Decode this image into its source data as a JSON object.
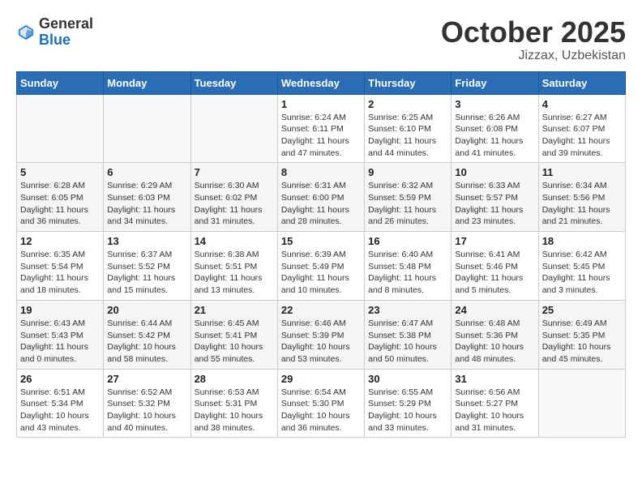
{
  "logo": {
    "general": "General",
    "blue": "Blue"
  },
  "title": "October 2025",
  "location": "Jizzax, Uzbekistan",
  "days_header": [
    "Sunday",
    "Monday",
    "Tuesday",
    "Wednesday",
    "Thursday",
    "Friday",
    "Saturday"
  ],
  "weeks": [
    [
      {
        "day": "",
        "info": ""
      },
      {
        "day": "",
        "info": ""
      },
      {
        "day": "",
        "info": ""
      },
      {
        "day": "1",
        "info": "Sunrise: 6:24 AM\nSunset: 6:11 PM\nDaylight: 11 hours\nand 47 minutes."
      },
      {
        "day": "2",
        "info": "Sunrise: 6:25 AM\nSunset: 6:10 PM\nDaylight: 11 hours\nand 44 minutes."
      },
      {
        "day": "3",
        "info": "Sunrise: 6:26 AM\nSunset: 6:08 PM\nDaylight: 11 hours\nand 41 minutes."
      },
      {
        "day": "4",
        "info": "Sunrise: 6:27 AM\nSunset: 6:07 PM\nDaylight: 11 hours\nand 39 minutes."
      }
    ],
    [
      {
        "day": "5",
        "info": "Sunrise: 6:28 AM\nSunset: 6:05 PM\nDaylight: 11 hours\nand 36 minutes."
      },
      {
        "day": "6",
        "info": "Sunrise: 6:29 AM\nSunset: 6:03 PM\nDaylight: 11 hours\nand 34 minutes."
      },
      {
        "day": "7",
        "info": "Sunrise: 6:30 AM\nSunset: 6:02 PM\nDaylight: 11 hours\nand 31 minutes."
      },
      {
        "day": "8",
        "info": "Sunrise: 6:31 AM\nSunset: 6:00 PM\nDaylight: 11 hours\nand 28 minutes."
      },
      {
        "day": "9",
        "info": "Sunrise: 6:32 AM\nSunset: 5:59 PM\nDaylight: 11 hours\nand 26 minutes."
      },
      {
        "day": "10",
        "info": "Sunrise: 6:33 AM\nSunset: 5:57 PM\nDaylight: 11 hours\nand 23 minutes."
      },
      {
        "day": "11",
        "info": "Sunrise: 6:34 AM\nSunset: 5:56 PM\nDaylight: 11 hours\nand 21 minutes."
      }
    ],
    [
      {
        "day": "12",
        "info": "Sunrise: 6:35 AM\nSunset: 5:54 PM\nDaylight: 11 hours\nand 18 minutes."
      },
      {
        "day": "13",
        "info": "Sunrise: 6:37 AM\nSunset: 5:52 PM\nDaylight: 11 hours\nand 15 minutes."
      },
      {
        "day": "14",
        "info": "Sunrise: 6:38 AM\nSunset: 5:51 PM\nDaylight: 11 hours\nand 13 minutes."
      },
      {
        "day": "15",
        "info": "Sunrise: 6:39 AM\nSunset: 5:49 PM\nDaylight: 11 hours\nand 10 minutes."
      },
      {
        "day": "16",
        "info": "Sunrise: 6:40 AM\nSunset: 5:48 PM\nDaylight: 11 hours\nand 8 minutes."
      },
      {
        "day": "17",
        "info": "Sunrise: 6:41 AM\nSunset: 5:46 PM\nDaylight: 11 hours\nand 5 minutes."
      },
      {
        "day": "18",
        "info": "Sunrise: 6:42 AM\nSunset: 5:45 PM\nDaylight: 11 hours\nand 3 minutes."
      }
    ],
    [
      {
        "day": "19",
        "info": "Sunrise: 6:43 AM\nSunset: 5:43 PM\nDaylight: 11 hours\nand 0 minutes."
      },
      {
        "day": "20",
        "info": "Sunrise: 6:44 AM\nSunset: 5:42 PM\nDaylight: 10 hours\nand 58 minutes."
      },
      {
        "day": "21",
        "info": "Sunrise: 6:45 AM\nSunset: 5:41 PM\nDaylight: 10 hours\nand 55 minutes."
      },
      {
        "day": "22",
        "info": "Sunrise: 6:46 AM\nSunset: 5:39 PM\nDaylight: 10 hours\nand 53 minutes."
      },
      {
        "day": "23",
        "info": "Sunrise: 6:47 AM\nSunset: 5:38 PM\nDaylight: 10 hours\nand 50 minutes."
      },
      {
        "day": "24",
        "info": "Sunrise: 6:48 AM\nSunset: 5:36 PM\nDaylight: 10 hours\nand 48 minutes."
      },
      {
        "day": "25",
        "info": "Sunrise: 6:49 AM\nSunset: 5:35 PM\nDaylight: 10 hours\nand 45 minutes."
      }
    ],
    [
      {
        "day": "26",
        "info": "Sunrise: 6:51 AM\nSunset: 5:34 PM\nDaylight: 10 hours\nand 43 minutes."
      },
      {
        "day": "27",
        "info": "Sunrise: 6:52 AM\nSunset: 5:32 PM\nDaylight: 10 hours\nand 40 minutes."
      },
      {
        "day": "28",
        "info": "Sunrise: 6:53 AM\nSunset: 5:31 PM\nDaylight: 10 hours\nand 38 minutes."
      },
      {
        "day": "29",
        "info": "Sunrise: 6:54 AM\nSunset: 5:30 PM\nDaylight: 10 hours\nand 36 minutes."
      },
      {
        "day": "30",
        "info": "Sunrise: 6:55 AM\nSunset: 5:29 PM\nDaylight: 10 hours\nand 33 minutes."
      },
      {
        "day": "31",
        "info": "Sunrise: 6:56 AM\nSunset: 5:27 PM\nDaylight: 10 hours\nand 31 minutes."
      },
      {
        "day": "",
        "info": ""
      }
    ]
  ]
}
